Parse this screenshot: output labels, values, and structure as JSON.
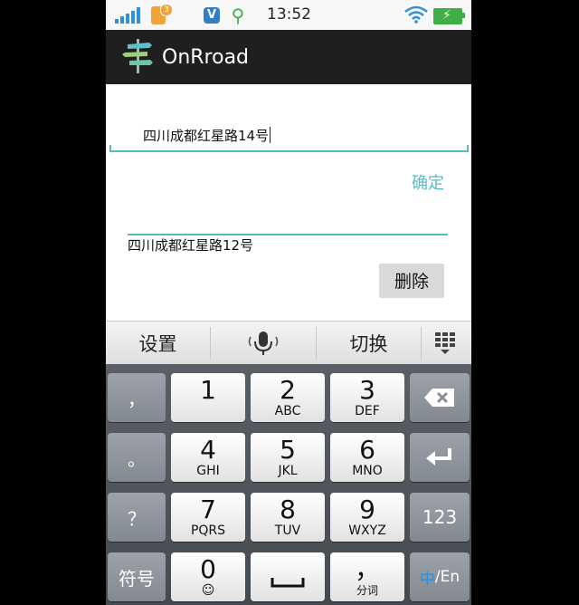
{
  "status_bar": {
    "time": "13:52",
    "notification_count": "3",
    "icons": [
      "signal-icon",
      "notification-badge-icon",
      "shield-icon",
      "usb-icon",
      "wifi-icon",
      "battery-icon"
    ]
  },
  "app": {
    "title": "OnRroad",
    "logo": "signpost-logo-icon"
  },
  "form": {
    "input_value": "四川成都红星路14号",
    "confirm_label": "确定",
    "saved_entry": "四川成都红星路12号",
    "delete_label": "删除"
  },
  "keyboard": {
    "toolbar": {
      "settings_label": "设置",
      "voice_icon": "microphone-icon",
      "switch_label": "切换",
      "grid_icon": "keyboard-grid-icon"
    },
    "left_column": {
      "comma": "，",
      "period": "。",
      "question": "？",
      "symbols": "符号"
    },
    "right_column": {
      "backspace_icon": "backspace-icon",
      "enter_icon": "enter-icon",
      "num_label": "123",
      "lang_cn": "中",
      "lang_sep": "/",
      "lang_en": "En"
    },
    "keys": [
      {
        "main": "1",
        "sub": ""
      },
      {
        "main": "2",
        "sub": "ABC"
      },
      {
        "main": "3",
        "sub": "DEF"
      },
      {
        "main": "4",
        "sub": "GHI"
      },
      {
        "main": "5",
        "sub": "JKL"
      },
      {
        "main": "6",
        "sub": "MNO"
      },
      {
        "main": "7",
        "sub": "PQRS"
      },
      {
        "main": "8",
        "sub": "TUV"
      },
      {
        "main": "9",
        "sub": "WXYZ"
      },
      {
        "main": "0",
        "sub": "☺"
      },
      {
        "main": "",
        "sub": ""
      },
      {
        "main": "，",
        "sub": "分词"
      }
    ]
  },
  "colors": {
    "accent": "#58b9c4",
    "action_bar": "#1f1f1f",
    "keyboard_bg": "#4f535a",
    "lang_active": "#2a8fd8"
  }
}
